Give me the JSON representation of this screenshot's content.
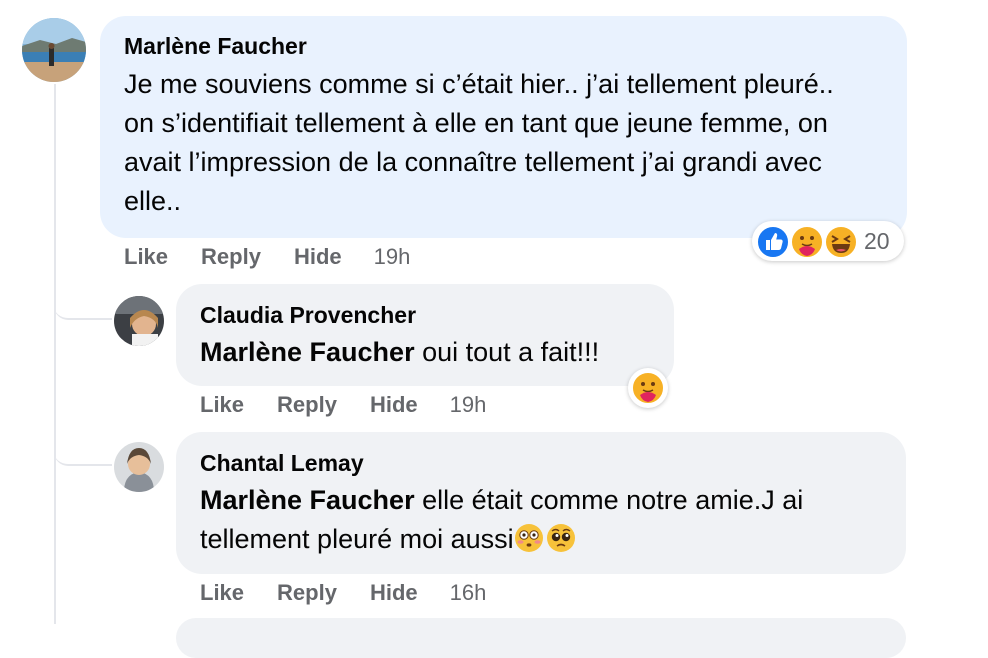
{
  "comments": [
    {
      "author": "Marlène Faucher",
      "text": "Je me souviens comme si c’était hier.. j’ai tellement pleuré.. on s’identifiait tellement à elle en tant que jeune femme, on avait l’impression de la connaître tellement j’ai grandi avec elle..",
      "actions": {
        "like": "Like",
        "reply": "Reply",
        "hide": "Hide",
        "time": "19h"
      },
      "reactions": {
        "icons": [
          "like-icon",
          "care-icon",
          "haha-icon"
        ],
        "count": "20"
      }
    },
    {
      "author": "Claudia Provencher",
      "mention": "Marlène Faucher",
      "text": " oui tout a fait!!!",
      "actions": {
        "like": "Like",
        "reply": "Reply",
        "hide": "Hide",
        "time": "19h"
      },
      "reactions": {
        "icons": [
          "care-icon"
        ]
      }
    },
    {
      "author": "Chantal Lemay",
      "mention": "Marlène Faucher",
      "text_line1": " elle était comme notre amie.J ai",
      "text_line2": "tellement pleuré moi aussi",
      "inline_emoji": [
        "flushed-face-icon",
        "pleading-face-icon"
      ],
      "actions": {
        "like": "Like",
        "reply": "Reply",
        "hide": "Hide",
        "time": "16h"
      }
    }
  ],
  "colors": {
    "main_bubble": "#e9f2fe",
    "reply_bubble": "#f0f2f5",
    "secondary_text": "#65676b",
    "like_blue": "#1877f2"
  }
}
